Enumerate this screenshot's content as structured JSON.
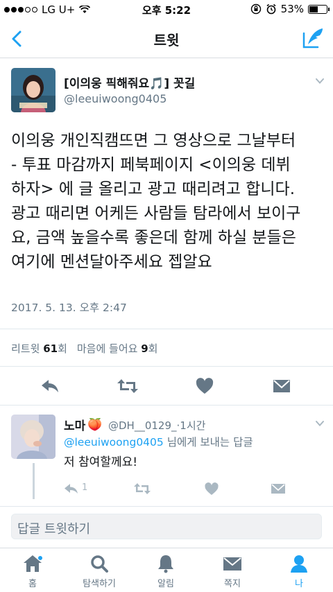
{
  "status": {
    "carrier": "LG U+",
    "time": "오후 5:22",
    "battery": "53%",
    "battery_level": 0.53,
    "signal_bars": 3
  },
  "nav": {
    "title": "트윗",
    "back_icon": "chevron-left-icon",
    "compose_icon": "compose-feather-icon"
  },
  "tweet": {
    "name": "[이의웅 픽해줘요🎵] 꼿길",
    "handle": "@leeuiwoong0405",
    "lines": [
      "이의웅 개인직캠뜨면 그 영상으로 그날부터",
      "- 투표 마감까지 페북페이지 <이의웅 데뷔",
      "하자> 에 글 올리고 광고 때리려고 합니다.",
      "광고 때리면 어케든 사람들 탐라에서 보이구",
      "요, 금액 높을수록 좋은데 함께 하실 분들은",
      "여기에 멘션달아주세요 젭알요"
    ],
    "date": "2017. 5. 13. 오후 2:47",
    "retweet_label": "리트윗",
    "retweet_count": "61",
    "retweet_unit": "회",
    "like_label": "마음에 들어요",
    "like_count": "9",
    "like_unit": "회"
  },
  "reply": {
    "name": "노마",
    "name_emoji": "🍑",
    "handle": "@DH__0129_",
    "time": "1시간",
    "to_mention": "@leeuiwoong0405",
    "to_suffix": "님에게 보내는 답글",
    "text": "저 참여할께요!",
    "reply_count": "1"
  },
  "composer": {
    "placeholder": "답글 트윗하기"
  },
  "tabs": [
    {
      "label": "홈",
      "icon": "home-icon"
    },
    {
      "label": "탐색하기",
      "icon": "search-icon"
    },
    {
      "label": "알림",
      "icon": "bell-icon"
    },
    {
      "label": "쪽지",
      "icon": "envelope-icon"
    },
    {
      "label": "나",
      "icon": "person-icon"
    }
  ],
  "colors": {
    "accent": "#1da1f2",
    "muted": "#657786",
    "action_gray": "#657786"
  }
}
